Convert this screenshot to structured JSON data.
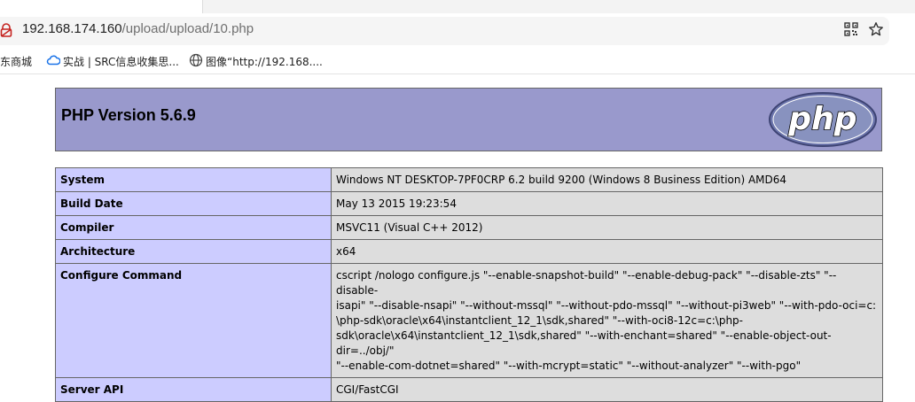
{
  "browser": {
    "url_host": "192.168.174.160",
    "url_path": "/upload/upload/10.php",
    "bookmarks": [
      {
        "label": "东商城"
      },
      {
        "label": "实战 | SRC信息收集思..."
      },
      {
        "label": "图像“http://192.168...."
      }
    ],
    "icons": {
      "lock": "insecure-lock-icon",
      "qr": "qr-code-icon",
      "star": "bookmark-star-icon"
    }
  },
  "php": {
    "title": "PHP Version 5.6.9",
    "logo_text": "php",
    "colors": {
      "header_bg": "#9999cc",
      "key_bg": "#ccccff",
      "value_bg": "#dddddd",
      "border": "#666666"
    },
    "rows": [
      {
        "key": "System",
        "value": "Windows NT DESKTOP-7PF0CRP 6.2 build 9200 (Windows 8 Business Edition) AMD64"
      },
      {
        "key": "Build Date",
        "value": "May 13 2015 19:23:54"
      },
      {
        "key": "Compiler",
        "value": "MSVC11 (Visual C++ 2012)"
      },
      {
        "key": "Architecture",
        "value": "x64"
      },
      {
        "key": "Configure Command",
        "value_lines": [
          "cscript /nologo configure.js \"--enable-snapshot-build\" \"--enable-debug-pack\" \"--disable-zts\" \"--disable-",
          "isapi\" \"--disable-nsapi\" \"--without-mssql\" \"--without-pdo-mssql\" \"--without-pi3web\" \"--with-pdo-oci=c:",
          "\\php-sdk\\oracle\\x64\\instantclient_12_1\\sdk,shared\" \"--with-oci8-12c=c:\\php-",
          "sdk\\oracle\\x64\\instantclient_12_1\\sdk,shared\" \"--with-enchant=shared\" \"--enable-object-out-dir=../obj/\"",
          "\"--enable-com-dotnet=shared\" \"--with-mcrypt=static\" \"--without-analyzer\" \"--with-pgo\""
        ]
      },
      {
        "key": "Server API",
        "value": "CGI/FastCGI"
      }
    ]
  }
}
